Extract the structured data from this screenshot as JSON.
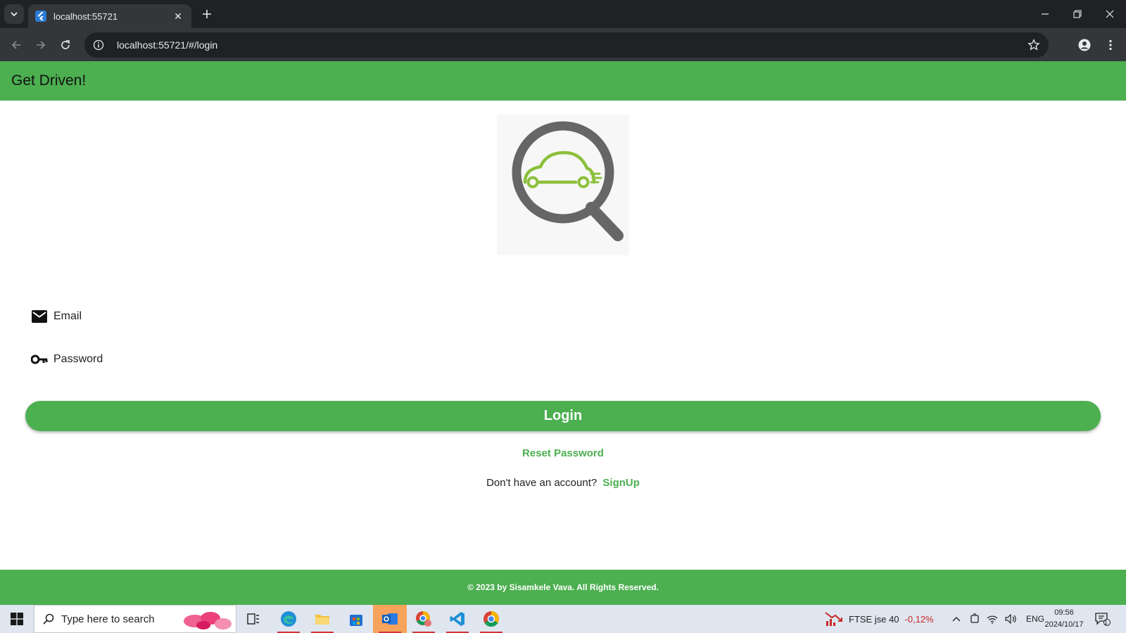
{
  "browser": {
    "tab_title": "localhost:55721",
    "url": "localhost:55721/#/login"
  },
  "app": {
    "title": "Get Driven!",
    "email_label": "Email",
    "password_label": "Password",
    "login_label": "Login",
    "reset_label": "Reset Password",
    "no_account_text": "Don't have an account?",
    "signup_label": "SignUp",
    "footer_text": "© 2023 by Sisamkele Vava. All Rights Reserved.",
    "accent_color": "#4caf50"
  },
  "taskbar": {
    "search_placeholder": "Type here to search",
    "stock_name": "FTSE jse 40",
    "stock_change": "-0,12%",
    "language": "ENG",
    "time": "09:56",
    "date": "2024/10/17",
    "notification_count": "1"
  }
}
